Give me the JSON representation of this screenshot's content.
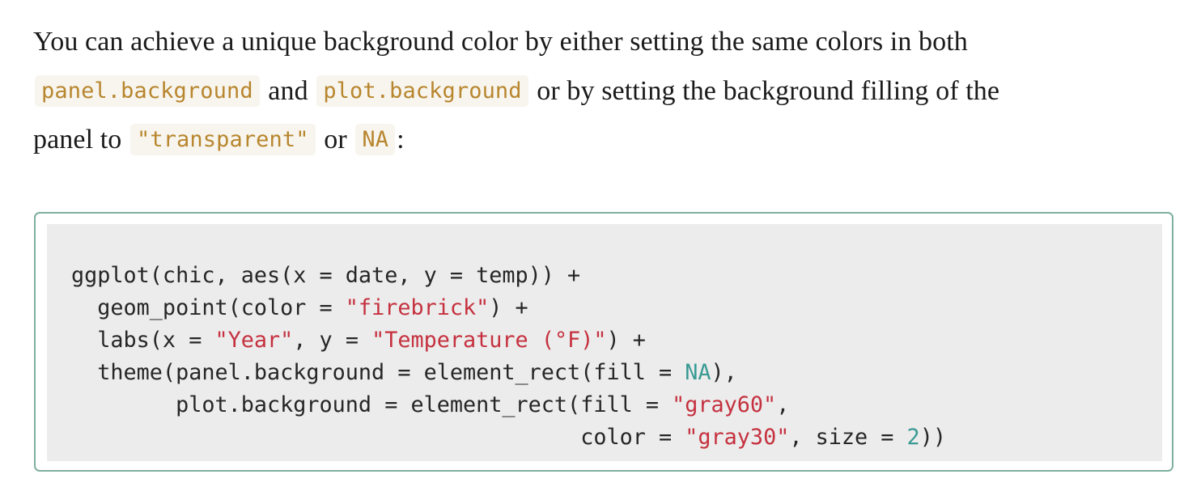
{
  "paragraph": {
    "line1": "You can achieve a unique background color by either setting the same colors in both",
    "code_panel_background": "panel.background",
    "and": "and",
    "code_plot_background": "plot.background",
    "line2_rest": "or by setting the background filling of the",
    "line3_start": "panel to",
    "code_transparent": "\"transparent\"",
    "or": "or",
    "code_na": "NA",
    "colon": ":"
  },
  "code": {
    "l1": "ggplot(chic, aes(x = date, y = temp)) +",
    "l2_a": "  geom_point(color = ",
    "l2_s": "\"firebrick\"",
    "l2_b": ") +",
    "l3_a": "  labs(x = ",
    "l3_s1": "\"Year\"",
    "l3_b": ", y = ",
    "l3_s2": "\"Temperature (°F)\"",
    "l3_c": ") +",
    "l4_a": "  theme(panel.background = element_rect(fill = ",
    "l4_na": "NA",
    "l4_b": "),",
    "l5_a": "        plot.background = element_rect(fill = ",
    "l5_s": "\"gray60\"",
    "l5_b": ",",
    "l6_a": "                                       color = ",
    "l6_s": "\"gray30\"",
    "l6_b": ", size = ",
    "l6_n": "2",
    "l6_c": "))"
  },
  "colors": {
    "inline_code_text": "#b8862e",
    "inline_code_bg": "#f7f5ee",
    "code_block_bg": "#ececec",
    "code_block_border": "#7fb09d",
    "string": "#c5313f",
    "number_literal": "#3a9a94"
  }
}
